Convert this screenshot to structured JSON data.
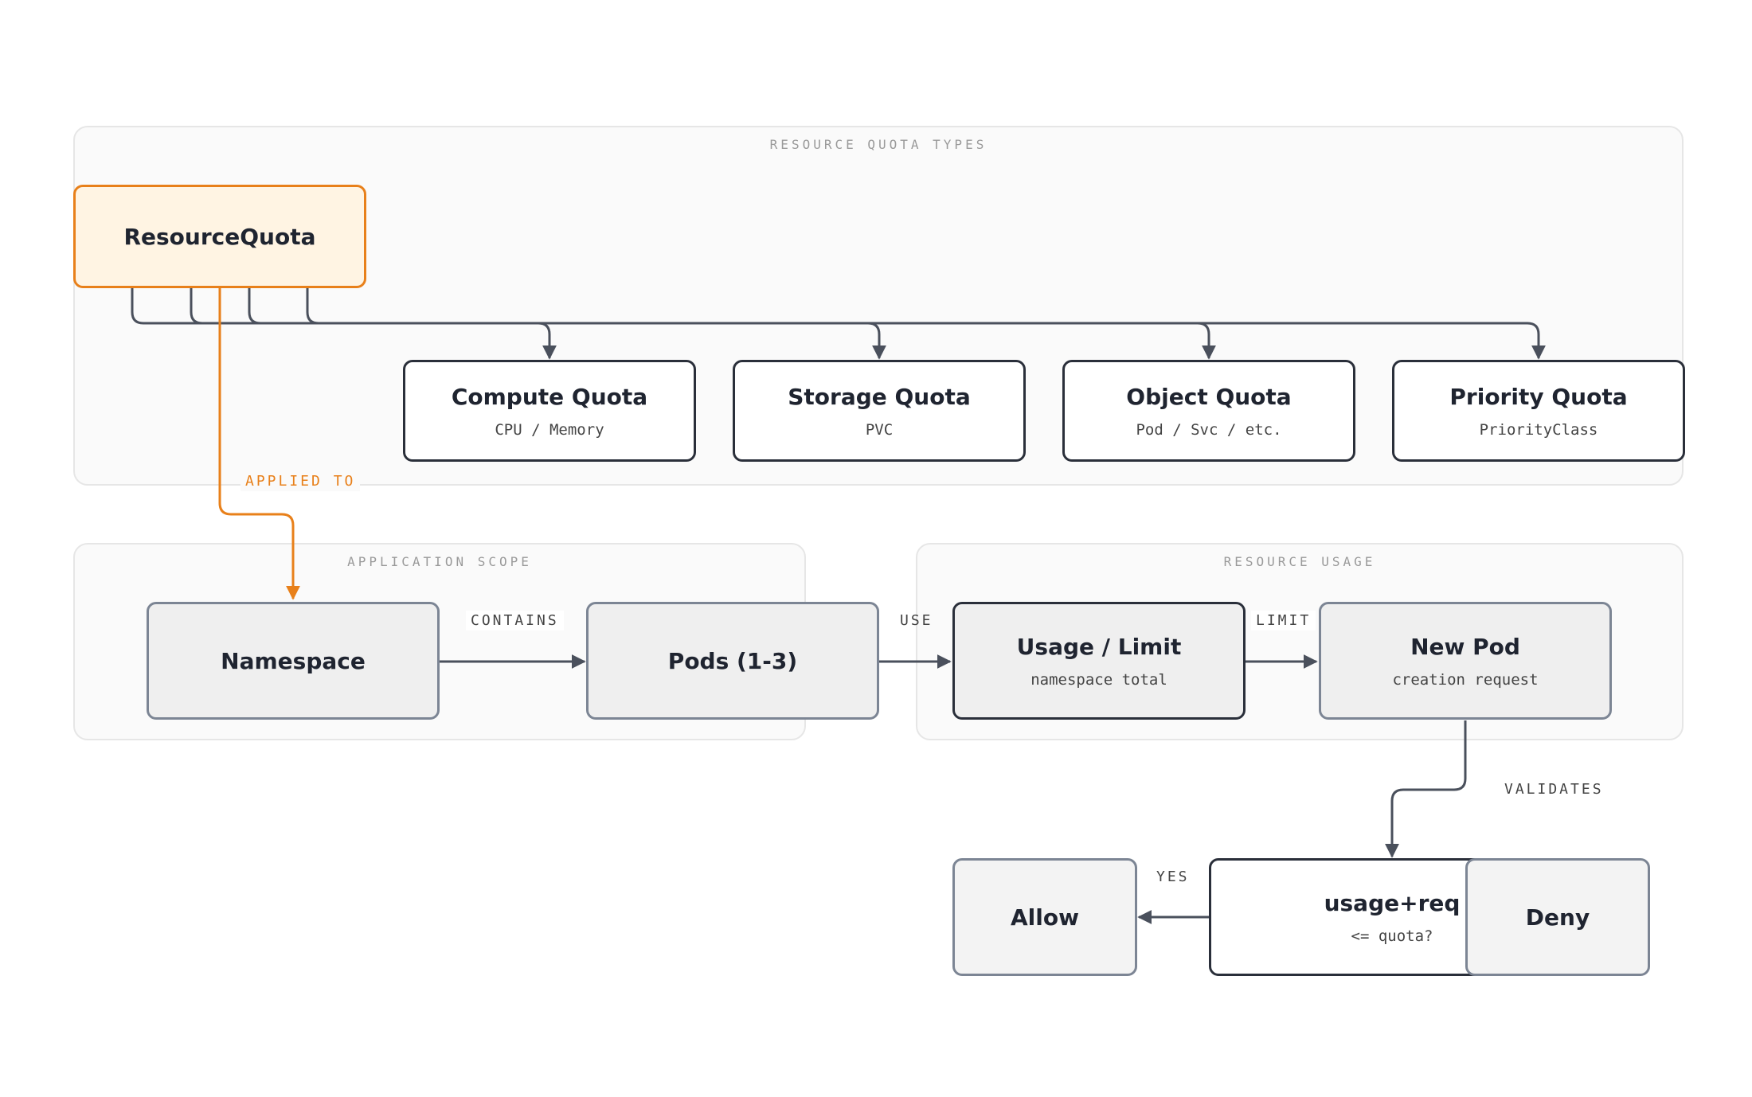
{
  "groups": {
    "quota_types": "RESOURCE QUOTA TYPES",
    "app_scope": "APPLICATION SCOPE",
    "usage": "RESOURCE USAGE"
  },
  "nodes": {
    "resource_quota": {
      "title": "ResourceQuota"
    },
    "compute": {
      "title": "Compute Quota",
      "sub": "CPU / Memory"
    },
    "storage": {
      "title": "Storage Quota",
      "sub": "PVC"
    },
    "object": {
      "title": "Object Quota",
      "sub": "Pod / Svc / etc."
    },
    "priority": {
      "title": "Priority Quota",
      "sub": "PriorityClass"
    },
    "namespace": {
      "title": "Namespace"
    },
    "pods": {
      "title": "Pods (1-3)"
    },
    "usage_limit": {
      "title": "Usage / Limit",
      "sub": "namespace total"
    },
    "new_pod": {
      "title": "New Pod",
      "sub": "creation request"
    },
    "check": {
      "title": "usage+req",
      "sub": "<= quota?"
    },
    "allow": {
      "title": "Allow"
    },
    "deny": {
      "title": "Deny"
    }
  },
  "edges": {
    "applied_to": "APPLIED TO",
    "contains": "CONTAINS",
    "use": "USE",
    "limit": "LIMIT",
    "validates": "VALIDATES",
    "yes": "YES"
  },
  "colors": {
    "accent": "#e8801a",
    "edge": "#4a505c",
    "node_border": "#2a2f3a",
    "group_bg": "#fafafa"
  }
}
